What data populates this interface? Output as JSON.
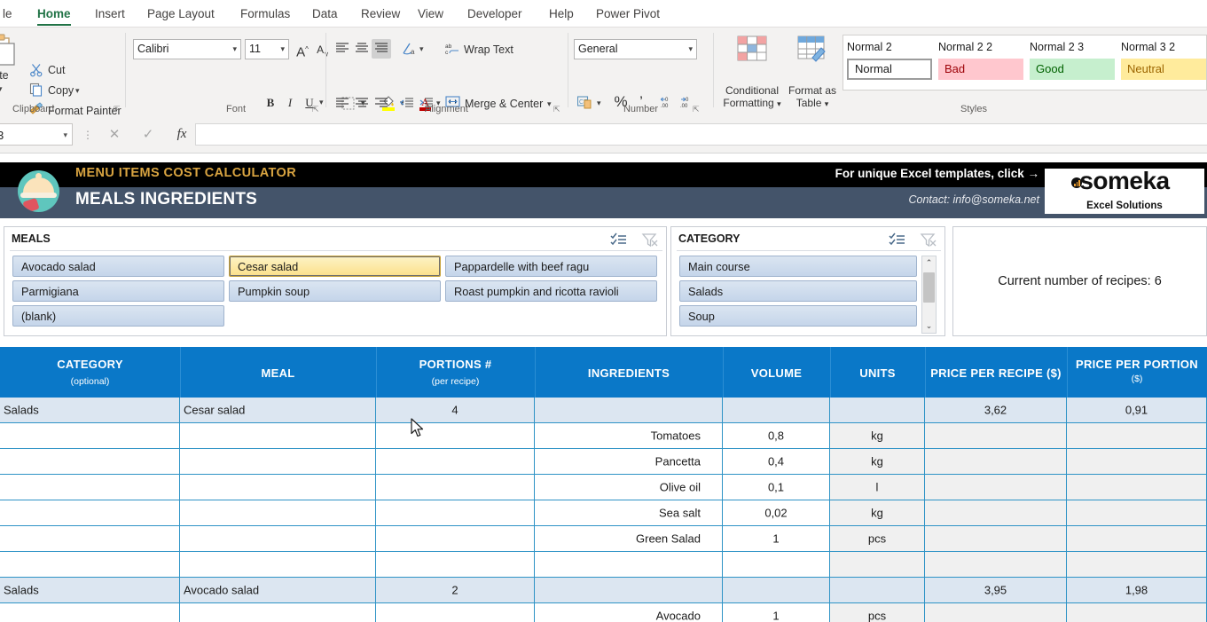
{
  "ribbon": {
    "tabs": [
      {
        "label": "le",
        "active": false
      },
      {
        "label": "Home",
        "active": true
      },
      {
        "label": "Insert",
        "active": false
      },
      {
        "label": "Page Layout",
        "active": false
      },
      {
        "label": "Formulas",
        "active": false
      },
      {
        "label": "Data",
        "active": false
      },
      {
        "label": "Review",
        "active": false
      },
      {
        "label": "View",
        "active": false
      },
      {
        "label": "Developer",
        "active": false
      },
      {
        "label": "Help",
        "active": false
      },
      {
        "label": "Power Pivot",
        "active": false
      }
    ],
    "clipboard": {
      "group_label": "Clipboard",
      "paste_label": "aste",
      "cut_label": "Cut",
      "copy_label": "Copy",
      "format_painter_label": "Format Painter"
    },
    "font": {
      "group_label": "Font",
      "family": "Calibri",
      "size": "11",
      "grow_label": "A",
      "shrink_label": "A",
      "bold_label": "B",
      "italic_label": "I",
      "underline_label": "U"
    },
    "alignment": {
      "group_label": "Alignment",
      "wrap_text_label": "Wrap Text",
      "merge_center_label": "Merge & Center"
    },
    "number": {
      "group_label": "Number",
      "format": "General",
      "percent_label": "%",
      "comma_label": "’"
    },
    "styles": {
      "group_label": "Styles",
      "conditional_formatting_label": "Conditional Formatting",
      "format_as_table_label": "Format as Table",
      "gallery": [
        {
          "name": "Normal 2",
          "chip": "Normal",
          "bg": "#ffffff",
          "fg": "#1b1b1b",
          "border": "#9c9c9c"
        },
        {
          "name": "Normal 2 2",
          "chip": "Bad",
          "bg": "#ffc7ce",
          "fg": "#9c0006",
          "border": ""
        },
        {
          "name": "Normal 2 3",
          "chip": "Good",
          "bg": "#c6efce",
          "fg": "#006100",
          "border": ""
        },
        {
          "name": "Normal 3 2",
          "chip": "Neutral",
          "bg": "#ffeb9c",
          "fg": "#9c6500",
          "border": ""
        }
      ]
    }
  },
  "formula_bar": {
    "name_box": "3",
    "cancel_icon": "✕",
    "enter_icon": "✓",
    "function_icon": "fx",
    "value": ""
  },
  "banner": {
    "kicker": "MENU ITEMS COST CALCULATOR",
    "title": "MEALS INGREDIENTS",
    "cta": "For unique Excel templates, click →",
    "contact": "Contact: info@someka.net",
    "logo_word": "someka",
    "logo_sub": "Excel Solutions",
    "colors": {
      "kicker": "#d9a441",
      "band": "#44546a",
      "top": "#000000"
    }
  },
  "slicers": {
    "meals": {
      "title": "MEALS",
      "multiselect_icon": "multi-select-icon",
      "clearfilter_icon": "clear-filter-icon",
      "items": [
        {
          "label": "Avocado salad",
          "selected": false
        },
        {
          "label": "Cesar salad",
          "selected": true
        },
        {
          "label": "Pappardelle with beef ragu",
          "selected": false
        },
        {
          "label": "Parmigiana",
          "selected": false
        },
        {
          "label": "Pumpkin soup",
          "selected": false
        },
        {
          "label": "Roast pumpkin and ricotta ravioli",
          "selected": false
        },
        {
          "label": "(blank)",
          "selected": false
        }
      ]
    },
    "category": {
      "title": "CATEGORY",
      "multiselect_icon": "multi-select-icon",
      "clearfilter_icon": "clear-filter-icon",
      "items": [
        {
          "label": "Main course",
          "selected": false
        },
        {
          "label": "Salads",
          "selected": false
        },
        {
          "label": "Soup",
          "selected": false
        }
      ],
      "scroll_up_icon": "⌃",
      "scroll_down_icon": "⌄"
    }
  },
  "count_box": {
    "text": "Current number of recipes: 6"
  },
  "table": {
    "header_color": "#0a78c8",
    "columns": [
      {
        "title": "CATEGORY",
        "sub": "(optional)"
      },
      {
        "title": "MEAL",
        "sub": ""
      },
      {
        "title": "PORTIONS #",
        "sub": "(per recipe)"
      },
      {
        "title": "INGREDIENTS",
        "sub": ""
      },
      {
        "title": "VOLUME",
        "sub": ""
      },
      {
        "title": "UNITS",
        "sub": ""
      },
      {
        "title": "PRICE PER RECIPE ($)",
        "sub": ""
      },
      {
        "title": "PRICE PER PORTION",
        "sub": "($)"
      }
    ],
    "rows": [
      {
        "kind": "meal",
        "category": "Salads",
        "meal": "Cesar salad",
        "portions": "4",
        "ingredient": "",
        "volume": "",
        "units": "",
        "price_recipe": "3,62",
        "price_portion": "0,91"
      },
      {
        "kind": "ing",
        "category": "",
        "meal": "",
        "portions": "",
        "ingredient": "Tomatoes",
        "volume": "0,8",
        "units": "kg",
        "price_recipe": "",
        "price_portion": ""
      },
      {
        "kind": "ing",
        "category": "",
        "meal": "",
        "portions": "",
        "ingredient": "Pancetta",
        "volume": "0,4",
        "units": "kg",
        "price_recipe": "",
        "price_portion": ""
      },
      {
        "kind": "ing",
        "category": "",
        "meal": "",
        "portions": "",
        "ingredient": "Olive oil",
        "volume": "0,1",
        "units": "l",
        "price_recipe": "",
        "price_portion": ""
      },
      {
        "kind": "ing",
        "category": "",
        "meal": "",
        "portions": "",
        "ingredient": "Sea salt",
        "volume": "0,02",
        "units": "kg",
        "price_recipe": "",
        "price_portion": ""
      },
      {
        "kind": "ing",
        "category": "",
        "meal": "",
        "portions": "",
        "ingredient": "Green Salad",
        "volume": "1",
        "units": "pcs",
        "price_recipe": "",
        "price_portion": ""
      },
      {
        "kind": "blank",
        "category": "",
        "meal": "",
        "portions": "",
        "ingredient": "",
        "volume": "",
        "units": "",
        "price_recipe": "",
        "price_portion": ""
      },
      {
        "kind": "meal",
        "category": "Salads",
        "meal": "Avocado salad",
        "portions": "2",
        "ingredient": "",
        "volume": "",
        "units": "",
        "price_recipe": "3,95",
        "price_portion": "1,98"
      },
      {
        "kind": "ing",
        "category": "",
        "meal": "",
        "portions": "",
        "ingredient": "Avocado",
        "volume": "1",
        "units": "pcs",
        "price_recipe": "",
        "price_portion": ""
      }
    ]
  }
}
